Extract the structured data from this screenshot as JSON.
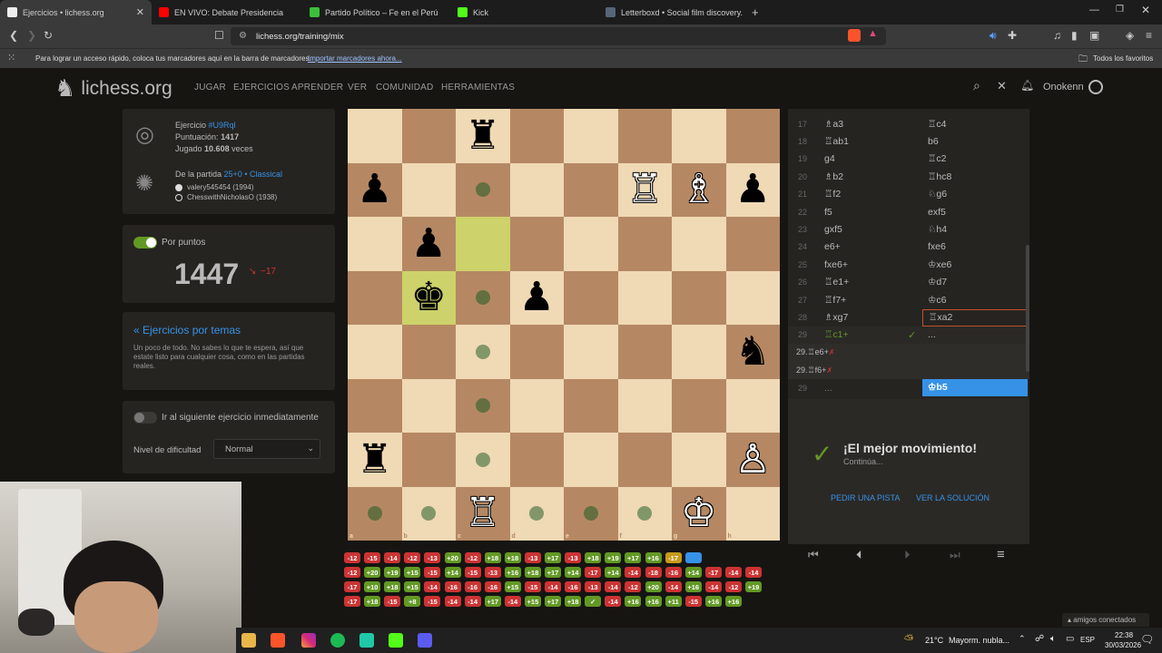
{
  "browser": {
    "tabs": [
      {
        "title": "Ejercicios • lichess.org",
        "fav": "#eeeeee",
        "active": true
      },
      {
        "title": "EN VIVO: Debate Presidencia",
        "fav": "#ff0000",
        "active": false
      },
      {
        "title": "Partido Político – Fe en el Perú",
        "fav": "#3bbf3b",
        "active": false
      },
      {
        "title": "Kick",
        "fav": "#53fc18",
        "active": false
      },
      {
        "title": "Letterboxd • Social film discovery.",
        "fav": "#556678",
        "active": false
      }
    ],
    "new_tab": "+",
    "url": "lichess.org/training/mix",
    "bookmark_hint": "Para lograr un acceso rápido, coloca tus marcadores aquí en la barra de marcadores.",
    "bookmark_import": "Importar marcadores ahora...",
    "bookmark_all": "Todos los favoritos"
  },
  "site": {
    "logo": "lichess.org",
    "nav": [
      "JUGAR",
      "EJERCICIOS",
      "APRENDER",
      "VER",
      "COMUNIDAD",
      "HERRAMIENTAS"
    ],
    "username": "Onokenn"
  },
  "puzzle": {
    "label_exercise": "Ejercicio",
    "id": "#U9Rql",
    "label_rating": "Puntuación:",
    "rating": "1417",
    "label_played": "Jugado",
    "played": "10.608",
    "played_suffix": "veces",
    "from_game_label": "De la partida",
    "game_type": "25+0 • Classical",
    "player_white": "valery545454 (1994)",
    "player_black": "ChesswithNicholasO (1938)"
  },
  "score": {
    "toggle_label": "Por puntos",
    "value": "1447",
    "delta": "−17"
  },
  "themes": {
    "title": "« Ejercicios por temas",
    "desc": "Un poco de todo. No sabes lo que te espera, así que estate listo para cualquier cosa, como en las partidas reales."
  },
  "settings": {
    "auto_next_label": "Ir al siguiente ejercicio inmediatamente",
    "difficulty_label": "Nivel de dificultad",
    "difficulty_value": "Normal"
  },
  "moves": [
    {
      "n": "17",
      "w": "♗a3",
      "b": "♖c4"
    },
    {
      "n": "18",
      "w": "♖ab1",
      "b": "b6"
    },
    {
      "n": "19",
      "w": "g4",
      "b": "♖c2"
    },
    {
      "n": "20",
      "w": "♗b2",
      "b": "♖hc8"
    },
    {
      "n": "21",
      "w": "♖f2",
      "b": "♘g6"
    },
    {
      "n": "22",
      "w": "f5",
      "b": "exf5"
    },
    {
      "n": "23",
      "w": "gxf5",
      "b": "♘h4"
    },
    {
      "n": "24",
      "w": "e6+",
      "b": "fxe6"
    },
    {
      "n": "25",
      "w": "fxe6+",
      "b": "♔xe6"
    },
    {
      "n": "26",
      "w": "♖e1+",
      "b": "♔d7"
    },
    {
      "n": "27",
      "w": "♖f7+",
      "b": "♔c6"
    },
    {
      "n": "28",
      "w": "♗xg7",
      "b": "♖xa2"
    },
    {
      "n": "29",
      "w": "♖c1+",
      "b": "..."
    }
  ],
  "variations": [
    "29.♖e6+",
    "29.♖f6+"
  ],
  "current_row": {
    "n": "29",
    "w": "...",
    "b": "♔b5"
  },
  "result": {
    "title": "¡El mejor movimiento!",
    "subtitle": "Continúa...",
    "hint": "PEDIR UNA PISTA",
    "solution": "VER LA SOLUCIÓN"
  },
  "board": {
    "files": [
      "a",
      "b",
      "c",
      "d",
      "e",
      "f",
      "g",
      "h"
    ],
    "ranks": [
      "8",
      "7",
      "6",
      "5",
      "4",
      "3",
      "2",
      "1"
    ],
    "pieces": [
      {
        "sq": "c8",
        "glyph": "♜",
        "color": "b"
      },
      {
        "sq": "a7",
        "glyph": "♟",
        "color": "b"
      },
      {
        "sq": "f7",
        "glyph": "♖",
        "color": "w"
      },
      {
        "sq": "g7",
        "glyph": "♗",
        "color": "w"
      },
      {
        "sq": "h7",
        "glyph": "♟",
        "color": "b"
      },
      {
        "sq": "b6",
        "glyph": "♟",
        "color": "b"
      },
      {
        "sq": "b5",
        "glyph": "♚",
        "color": "b"
      },
      {
        "sq": "d5",
        "glyph": "♟",
        "color": "b"
      },
      {
        "sq": "h4",
        "glyph": "♞",
        "color": "b"
      },
      {
        "sq": "a2",
        "glyph": "♜",
        "color": "b"
      },
      {
        "sq": "h2",
        "glyph": "♙",
        "color": "w"
      },
      {
        "sq": "c1",
        "glyph": "♖",
        "color": "w"
      },
      {
        "sq": "g1",
        "glyph": "♔",
        "color": "w"
      }
    ],
    "highlights": [
      "c6",
      "b5"
    ],
    "moves_dots": [
      "c7",
      "c5",
      "c4",
      "c3",
      "c2",
      "a1",
      "b1",
      "d1",
      "e1",
      "f1"
    ]
  },
  "streaks": [
    [
      "-12",
      "-15",
      "-14",
      "-12",
      "-13",
      "+20",
      "-12",
      "+18",
      "+18",
      "-13",
      "+17",
      "-13",
      "+18",
      "+19",
      "+17",
      "+16",
      "-17",
      "~"
    ],
    [
      "-12",
      "+20",
      "+19",
      "+15",
      "-15",
      "+14",
      "-15",
      "-13",
      "+16",
      "+18",
      "+17",
      "+14",
      "-17",
      "+14",
      "-14",
      "-18",
      "-16",
      "+14",
      "-17",
      "-14",
      "-14"
    ],
    [
      "-17",
      "+10",
      "+18",
      "+15",
      "-14",
      "-16",
      "-16",
      "-16",
      "+15",
      "-15",
      "-14",
      "-16",
      "-13",
      "-14",
      "-12",
      "+20",
      "-14",
      "+16",
      "-14",
      "-12",
      "+19"
    ],
    [
      "-17",
      "+18",
      "-15",
      "+8",
      "-15",
      "-14",
      "-14",
      "+17",
      "-14",
      "+15",
      "+17",
      "+18",
      "✓",
      "-14",
      "+16",
      "+16",
      "+11",
      "-15",
      "+16",
      "+16"
    ]
  ],
  "taskbar": {
    "weather_temp": "21°C",
    "weather_desc": "Mayorm. nubla...",
    "lang": "ESP",
    "time": "22:38",
    "date": "30/03/2026",
    "friends": "amigos conectados"
  }
}
